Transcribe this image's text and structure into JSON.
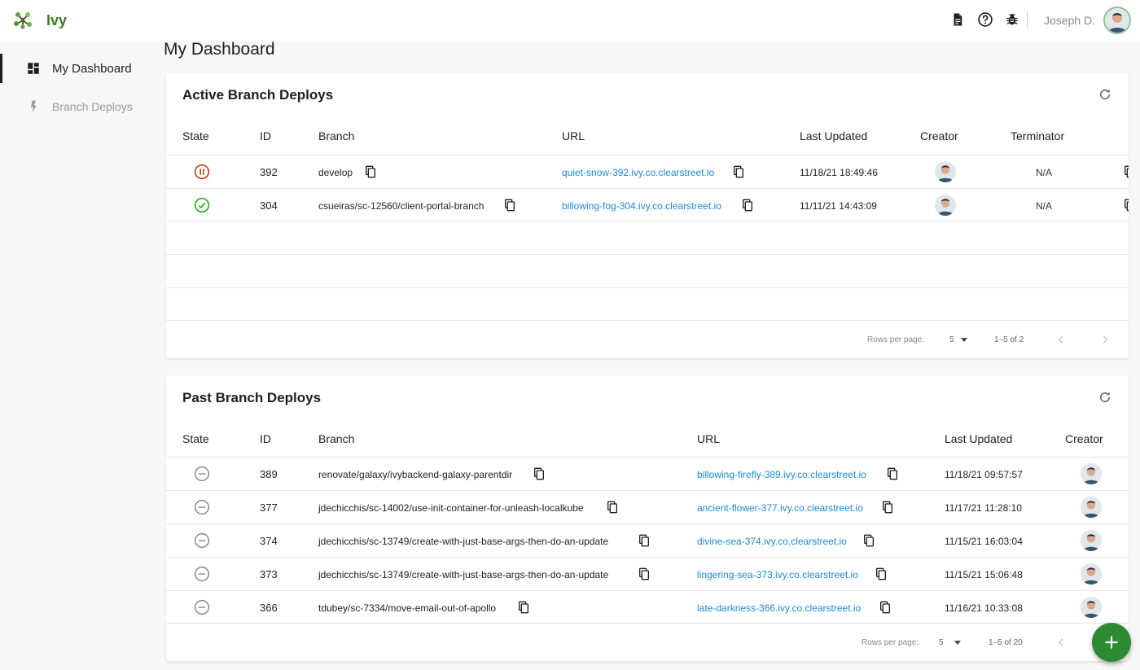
{
  "app": {
    "name": "Ivy"
  },
  "header": {
    "user_name": "Joseph D.",
    "icons": [
      "document-icon",
      "help-icon",
      "bug-icon"
    ]
  },
  "sidebar": {
    "items": [
      {
        "label": "My Dashboard",
        "icon": "dashboard-icon",
        "active": true
      },
      {
        "label": "Branch Deploys",
        "icon": "bolt-icon",
        "active": false
      }
    ]
  },
  "page": {
    "title": "My Dashboard"
  },
  "active_deploys": {
    "title": "Active Branch Deploys",
    "columns": [
      "State",
      "ID",
      "Branch",
      "URL",
      "Last Updated",
      "Creator",
      "Terminator"
    ],
    "rows": [
      {
        "state": "paused",
        "id": "392",
        "branch": "develop",
        "url": "quiet-snow-392.ivy.co.clearstreet.io",
        "updated": "11/18/21 18:49:46",
        "terminator": "N/A"
      },
      {
        "state": "success",
        "id": "304",
        "branch": "csueiras/sc-12560/client-portal-branch",
        "url": "billowing-fog-304.ivy.co.clearstreet.io",
        "updated": "11/11/21 14:43:09",
        "terminator": "N/A"
      }
    ],
    "pagination": {
      "rows_label": "Rows per page:",
      "rows_value": "5",
      "range": "1–5 of 2"
    }
  },
  "past_deploys": {
    "title": "Past Branch Deploys",
    "columns": [
      "State",
      "ID",
      "Branch",
      "URL",
      "Last Updated",
      "Creator"
    ],
    "rows": [
      {
        "state": "terminated",
        "id": "389",
        "branch": "renovate/galaxy/ivybackend-galaxy-parentdir",
        "url": "billowing-firefly-389.ivy.co.clearstreet.io",
        "updated": "11/18/21 09:57:57"
      },
      {
        "state": "terminated",
        "id": "377",
        "branch": "jdechicchis/sc-14002/use-init-container-for-unleash-localkube",
        "url": "ancient-flower-377.ivy.co.clearstreet.io",
        "updated": "11/17/21 11:28:10"
      },
      {
        "state": "terminated",
        "id": "374",
        "branch": "jdechicchis/sc-13749/create-with-just-base-args-then-do-an-update",
        "url": "divine-sea-374.ivy.co.clearstreet.io",
        "updated": "11/15/21 16:03:04"
      },
      {
        "state": "terminated",
        "id": "373",
        "branch": "jdechicchis/sc-13749/create-with-just-base-args-then-do-an-update",
        "url": "lingering-sea-373.ivy.co.clearstreet.io",
        "updated": "11/15/21 15:06:48"
      },
      {
        "state": "terminated",
        "id": "366",
        "branch": "tdubey/sc-7334/move-email-out-of-apollo",
        "url": "late-darkness-366.ivy.co.clearstreet.io",
        "updated": "11/16/21 10:33:08"
      }
    ],
    "pagination": {
      "rows_label": "Rows per page:",
      "rows_value": "5",
      "range": "1–5 of 20"
    }
  },
  "colors": {
    "brand": "#3c7a22",
    "link": "#1b8bd6",
    "paused": "#c8441b",
    "success": "#2eaa1f",
    "terminated": "#888888",
    "fab": "#2e8a32"
  },
  "fab": {
    "icon": "plus-icon"
  }
}
